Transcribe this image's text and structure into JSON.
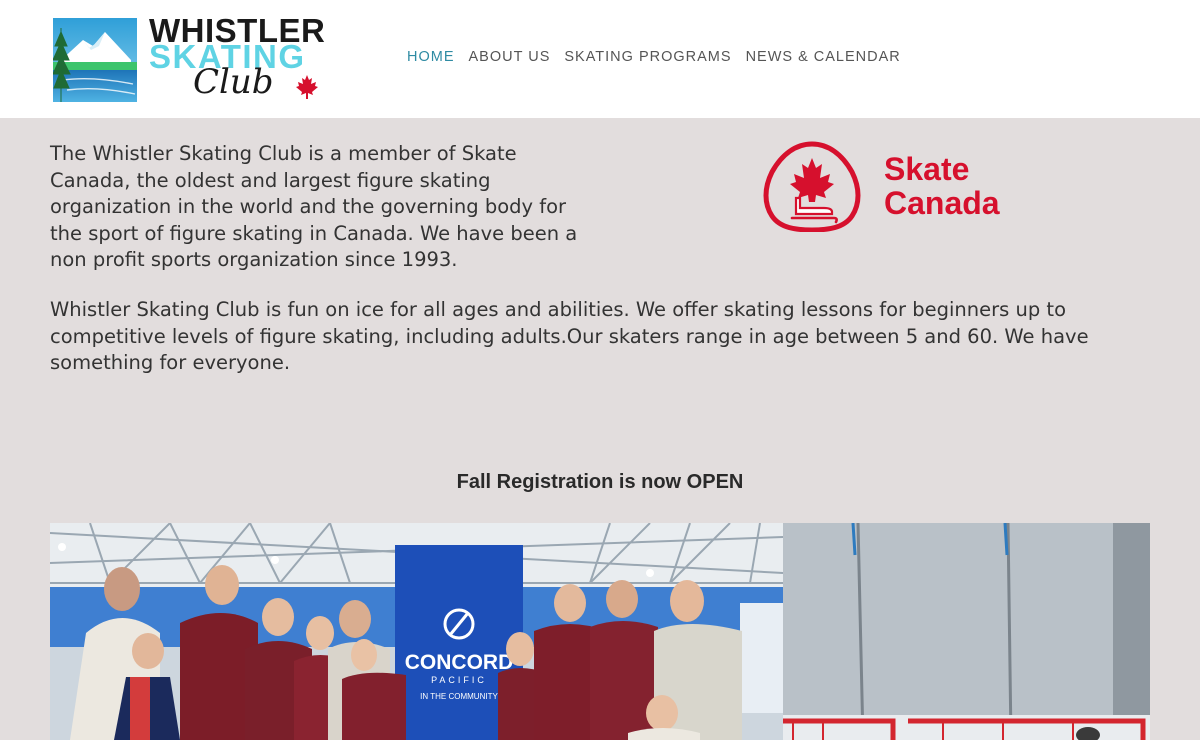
{
  "header": {
    "logo": {
      "line1": "WHISTLER",
      "line2": "SKATING",
      "line3": "Club"
    },
    "nav": [
      {
        "label": "HOME",
        "active": true
      },
      {
        "label": "ABOUT US",
        "active": false
      },
      {
        "label": "SKATING PROGRAMS",
        "active": false
      },
      {
        "label": "NEWS & CALENDAR",
        "active": false
      }
    ]
  },
  "main": {
    "intro": "The Whistler Skating Club is a member of Skate Canada, the oldest and largest figure skating organization in the world and the governing body for the sport of figure skating in Canada. We have been a non profit sports organization since 1993.",
    "partner_logo": {
      "line1": "Skate",
      "line2": "Canada"
    },
    "about": "Whistler Skating Club is fun on ice for all ages and abilities. We offer skating lessons for beginners up to competitive levels of figure skating, including adults.Our skaters range in age between 5 and 60. We have something for everyone.",
    "registration_heading": "Fall Registration is now OPEN",
    "banner": {
      "line1": "CONCORD",
      "line2": "PACIFIC",
      "line3": "IN THE COMMUNITY"
    }
  },
  "colors": {
    "accent": "#2f8ba3",
    "brand_cyan": "#5fd3e4",
    "skate_canada_red": "#d6102d",
    "page_background": "#e2dddd"
  },
  "icons": [
    "mountain-lake-logo-icon",
    "maple-leaf-icon",
    "skate-canada-emblem-icon"
  ]
}
